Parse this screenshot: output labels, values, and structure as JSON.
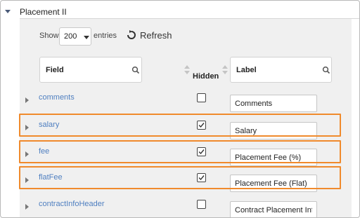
{
  "section": {
    "title": "Placement II"
  },
  "toolbar": {
    "show_label": "Show",
    "entries_value": "200",
    "entries_label": "entries",
    "refresh_label": "Refresh"
  },
  "columns": {
    "field": "Field",
    "hidden": "Hidden",
    "label": "Label"
  },
  "rows": [
    {
      "field": "comments",
      "hidden": false,
      "label": "Comments",
      "highlighted": false
    },
    {
      "field": "salary",
      "hidden": true,
      "label": "Salary",
      "highlighted": true
    },
    {
      "field": "fee",
      "hidden": true,
      "label": "Placement Fee (%)",
      "highlighted": true
    },
    {
      "field": "flatFee",
      "hidden": true,
      "label": "Placement Fee (Flat)",
      "highlighted": true
    },
    {
      "field": "contractInfoHeader",
      "hidden": false,
      "label": "Contract Placement Inf",
      "highlighted": false
    }
  ],
  "colors": {
    "highlight": "#f08a2c",
    "field_link": "#4f7fc0",
    "panel_bg": "#f0f0f0"
  },
  "icons": {
    "section_toggle": "caret-down-icon",
    "refresh": "refresh-icon",
    "search": "search-icon",
    "sort": "sort-icon",
    "row_expand": "caret-right-icon",
    "check": "check-icon"
  }
}
